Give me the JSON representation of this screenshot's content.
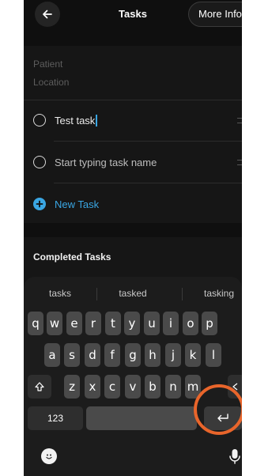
{
  "header": {
    "title": "Tasks",
    "more_label": "More Info"
  },
  "info": {
    "patient_placeholder": "Patient",
    "location_placeholder": "Location"
  },
  "tasks": [
    {
      "text": "Test task"
    },
    {
      "placeholder": "Start typing task name"
    }
  ],
  "new_task_label": "New Task",
  "completed_label": "Completed Tasks",
  "keyboard": {
    "suggestions": [
      "tasks",
      "tasked",
      "tasking"
    ],
    "row1": [
      "q",
      "w",
      "e",
      "r",
      "t",
      "y",
      "u",
      "i",
      "o",
      "p"
    ],
    "row2": [
      "a",
      "s",
      "d",
      "f",
      "g",
      "h",
      "j",
      "k",
      "l"
    ],
    "row3": [
      "z",
      "x",
      "c",
      "v",
      "b",
      "n",
      "m"
    ],
    "numbers_label": "123"
  },
  "colors": {
    "accent": "#3aa6e3",
    "highlight_ring": "#e8652b"
  }
}
